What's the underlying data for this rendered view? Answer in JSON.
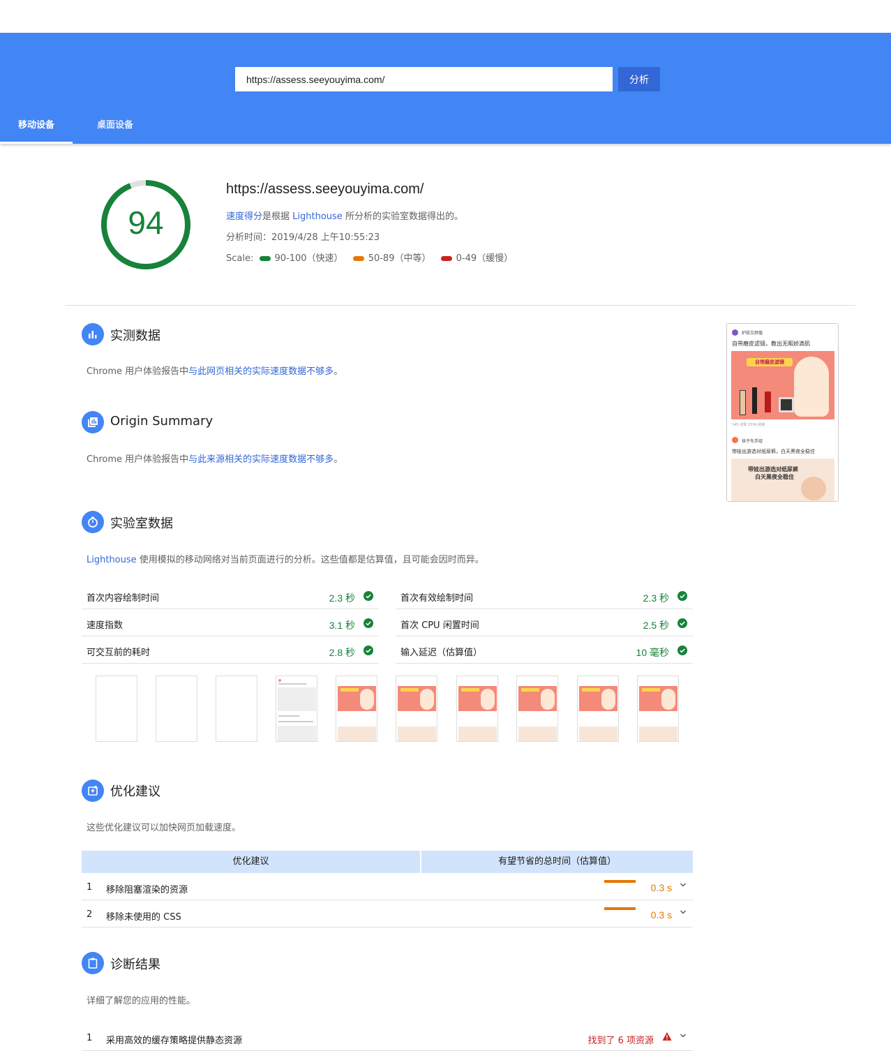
{
  "header": {
    "url_value": "https://assess.seeyouyima.com/",
    "analyze_label": "分析",
    "tabs": [
      {
        "label": "移动设备"
      },
      {
        "label": "桌面设备"
      }
    ]
  },
  "summary": {
    "score": "94",
    "url": "https://assess.seeyouyima.com/",
    "desc_link1": "速度得分",
    "desc_mid": "是根据 ",
    "desc_link2": "Lighthouse",
    "desc_end": " 所分析的实验室数据得出的。",
    "analysis_time": "分析时间：2019/4/28 上午10:55:23",
    "scale_label": "Scale:",
    "scale": [
      {
        "label": "90-100（快速）",
        "color": "#178239"
      },
      {
        "label": "50-89（中等）",
        "color": "#e67700"
      },
      {
        "label": "0-49（缓慢）",
        "color": "#c7221f"
      }
    ]
  },
  "field": {
    "title": "实测数据",
    "desc_prefix": "Chrome 用户体验报告中",
    "desc_link": "与此网页相关的实际速度数据不够多",
    "desc_suffix": "。"
  },
  "origin": {
    "title": "Origin Summary",
    "desc_prefix": "Chrome 用户体验报告中",
    "desc_link": "与此来源相关的实际速度数据不够多",
    "desc_suffix": "。"
  },
  "lab": {
    "title": "实验室数据",
    "desc_link": "Lighthouse",
    "desc_rest": " 使用模拟的移动网络对当前页面进行的分析。这些值都是估算值，且可能会因时而异。",
    "metrics": [
      {
        "label": "首次内容绘制时间",
        "value": "2.3 秒"
      },
      {
        "label": "首次有效绘制时间",
        "value": "2.3 秒"
      },
      {
        "label": "速度指数",
        "value": "3.1 秒"
      },
      {
        "label": "首次 CPU 闲置时间",
        "value": "2.5 秒"
      },
      {
        "label": "可交互前的耗时",
        "value": "2.8 秒"
      },
      {
        "label": "输入延迟（估算值）",
        "value": "10 毫秒"
      }
    ]
  },
  "preview": {
    "post1_author": "护肤又颜值",
    "post1_title": "自带磨皮滤镜，教出无暇娇滴肌",
    "post1_banner": "自带磨皮滤镜",
    "post1_meta": "145 点赞  2334 阅读",
    "post2_author": "袜子先手组",
    "post2_title": "带娃出游选对纸尿裤，白天黑夜全稳住",
    "post2_banner1": "带娃出游选对纸尿裤",
    "post2_banner2": "白天黑夜全稳住"
  },
  "opportunities": {
    "title": "优化建议",
    "desc": "这些优化建议可以加快网页加载速度。",
    "col1": "优化建议",
    "col2": "有望节省的总时间（估算值）",
    "items": [
      {
        "num": "1",
        "label": "移除阻塞渲染的资源",
        "saving": "0.3 s"
      },
      {
        "num": "2",
        "label": "移除未使用的 CSS",
        "saving": "0.3 s"
      }
    ]
  },
  "diagnostics": {
    "title": "诊断结果",
    "desc": "详细了解您的应用的性能。",
    "items": [
      {
        "num": "1",
        "label": "采用高效的缓存策略提供静态资源",
        "found": "找到了 6 项资源"
      }
    ]
  },
  "colors": {
    "accent": "#4285f4",
    "pass": "#178239",
    "average": "#e67700",
    "fail": "#c7221f"
  }
}
